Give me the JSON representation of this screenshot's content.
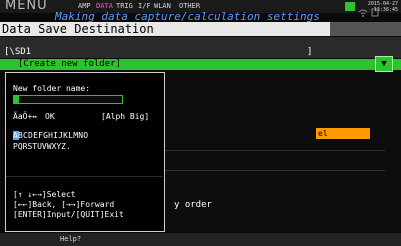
{
  "header": {
    "menu_label": "MENU",
    "tabs": [
      "AMP",
      "DATA",
      "TRIG",
      "I/F",
      "WLAN",
      "OTHER"
    ],
    "active_tab": "DATA",
    "date": "2015-04-27",
    "time": "13:36:45"
  },
  "subtitle": "Making data capture/calculation settings",
  "dialog_title": "Data Save Destination",
  "path": {
    "text": "[\\SD1",
    "close_bracket": "]"
  },
  "create_folder_label": "[Create new folder]",
  "green_button_label": "▼",
  "background": {
    "selected_fragment": "el",
    "order_text": "y order"
  },
  "new_folder_dialog": {
    "label": "New folder name:",
    "value": "",
    "mode_icon_text": "ÃaÖ+↔",
    "ok_label": "OK",
    "mode_label": "[Alph Big]",
    "char_row_1": "ABCDEFGHIJKLMNO",
    "char_row_2": "PQRSTUVWXYZ.",
    "selected_char": "A",
    "help_lines": [
      "[↑ ↓←→]Select",
      "[←←]Back, [→→]Forward",
      "[ENTER]Input/[QUIT]Exit"
    ]
  },
  "footer": {
    "help_label": "Help?"
  },
  "colors": {
    "accent_green": "#2ec22e",
    "accent_orange": "#ff9900",
    "active_tab": "#ff4fd8",
    "subtitle": "#5a9cff"
  }
}
